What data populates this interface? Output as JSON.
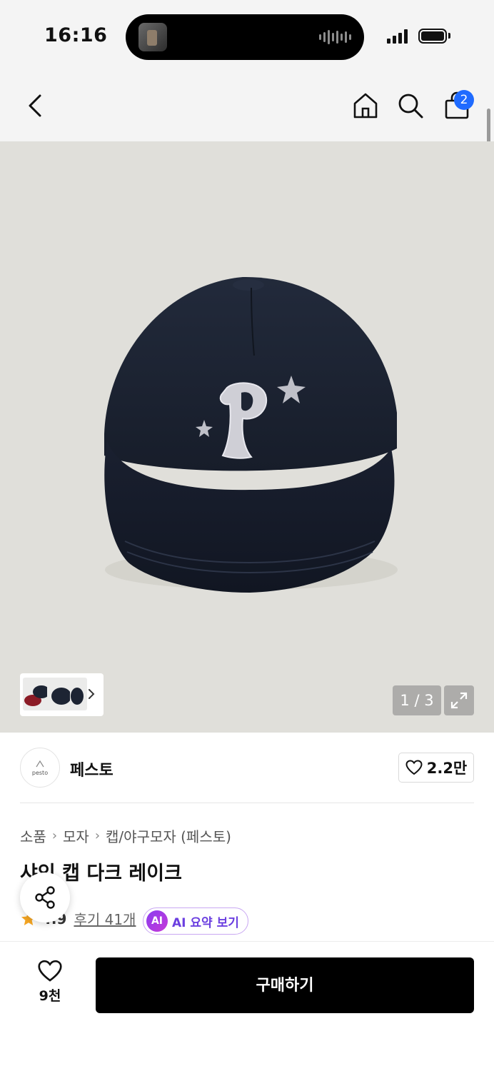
{
  "status_bar": {
    "time": "16:16"
  },
  "nav": {
    "cart_badge": "2",
    "icons": [
      "chevron-left-icon",
      "home-icon",
      "search-icon",
      "shopping-bag-icon"
    ]
  },
  "gallery": {
    "page_counter": "1 / 3",
    "current_page": 1,
    "total_pages": 3
  },
  "brand": {
    "name": "페스토",
    "logo_text": "pesto",
    "like_count": "2.2만"
  },
  "breadcrumb": [
    "소품",
    "모자",
    "캡/야구모자 (페스토)"
  ],
  "product": {
    "title": "샤인 캡 다크 레이크",
    "rating": "4.9",
    "reviews_label": "후기 41개",
    "ai_summary_label": "AI 요약 보기",
    "ai_badge": "AI"
  },
  "bottom_bar": {
    "wish_count": "9천",
    "buy_label": "구매하기"
  },
  "colors": {
    "accent_badge": "#1f6bff",
    "ai_purple": "#6b3fe0",
    "star": "#f5a623",
    "cap_navy": "#1d2433"
  }
}
